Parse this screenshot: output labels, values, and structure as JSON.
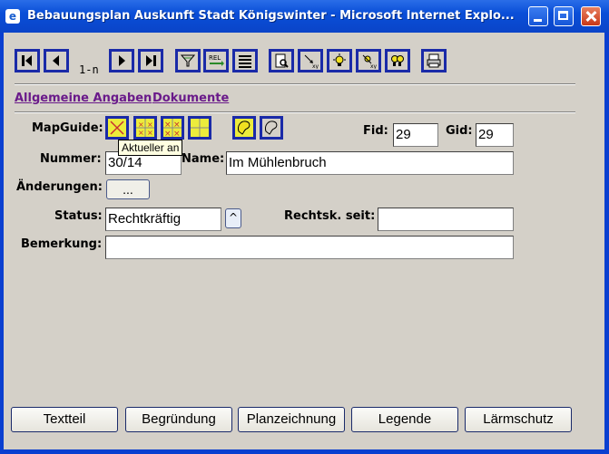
{
  "window": {
    "title": "Bebauungsplan Auskunft Stadt Königswinter - Microsoft Internet Explo..."
  },
  "toolbar": {
    "range_label": "1-n",
    "buttons": [
      "first-record",
      "previous-record",
      "next-record",
      "last-record",
      "filter",
      "relation",
      "list-view",
      "search-document",
      "zoom-xy",
      "highlight",
      "highlight-off",
      "group",
      "print"
    ],
    "rel_text": "REL"
  },
  "tabs": {
    "general": "Allgemeine Angaben",
    "documents": "Dokumente"
  },
  "form": {
    "mapguide_label": "MapGuide:",
    "mapguide_tooltip": "Aktueller an",
    "fid_label": "Fid:",
    "fid_value": "29",
    "gid_label": "Gid:",
    "gid_value": "29",
    "nummer_label": "Nummer:",
    "nummer_value": "30/14",
    "name_label": "Name:",
    "name_value": "Im Mühlenbruch",
    "aenderungen_label": "Änderungen:",
    "aenderungen_button": "...",
    "status_label": "Status:",
    "status_value": "Rechtkräftig",
    "spin_symbol": "^",
    "rechtsk_label": "Rechtsk. seit:",
    "rechtsk_value": "",
    "bemerkung_label": "Bemerkung:",
    "bemerkung_value": ""
  },
  "bottom_buttons": [
    "Textteil",
    "Begründung",
    "Planzeichnung",
    "Legende",
    "Lärmschutz"
  ],
  "colors": {
    "title_bar": "#0a4fd8",
    "client_bg": "#d4d0c8",
    "button_border": "#1a2aa8",
    "link": "#6a1a8a",
    "mapguide_yellow": "#ecec3c"
  }
}
